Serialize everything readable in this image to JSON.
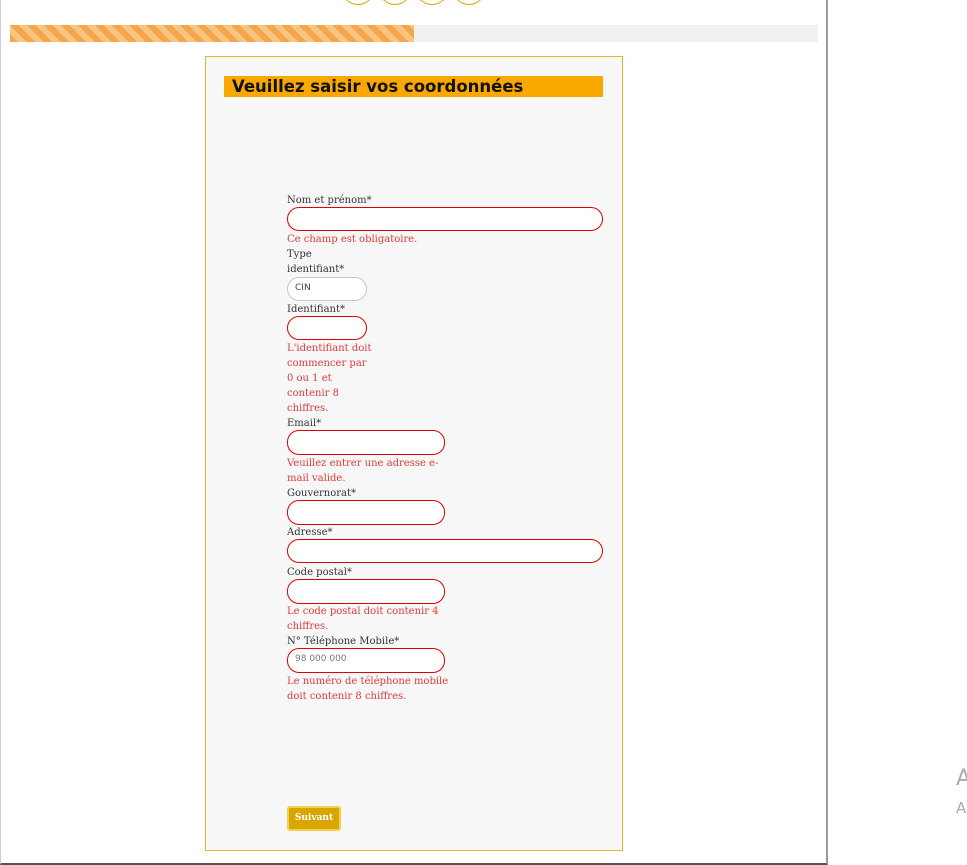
{
  "progress": {
    "value": 0.5
  },
  "form": {
    "title": "Veuillez saisir vos coordonnées",
    "nom_label": "Nom et prénom*",
    "nom_error": "Ce champ est obligatoire.",
    "type_label_1": "Type",
    "type_label_2": "identifiant*",
    "type_value": "CIN",
    "id_label": "Identifiant*",
    "id_error": [
      "L'identifiant doit",
      "commencer par",
      "0 ou 1 et",
      "contenir 8",
      "chiffres."
    ],
    "email_label": "Email*",
    "email_error": [
      "Veuillez entrer une adresse e-",
      "mail valide."
    ],
    "gov_label": "Gouvernorat*",
    "adresse_label": "Adresse*",
    "cp_label": "Code postal*",
    "cp_error": [
      "Le code postal doit contenir 4",
      "chiffres."
    ],
    "tel_label": "N° Téléphone Mobile*",
    "tel_placeholder": "98 000 000",
    "tel_error": [
      "Le numéro de téléphone mobile",
      "doit contenir 8 chiffres."
    ],
    "submit_label": "Suivant"
  },
  "side": {
    "letter_large": "A",
    "letter_small": "A"
  },
  "colors": {
    "accent": "#f9a800",
    "error": "#e00000",
    "button": "#d9a500"
  }
}
